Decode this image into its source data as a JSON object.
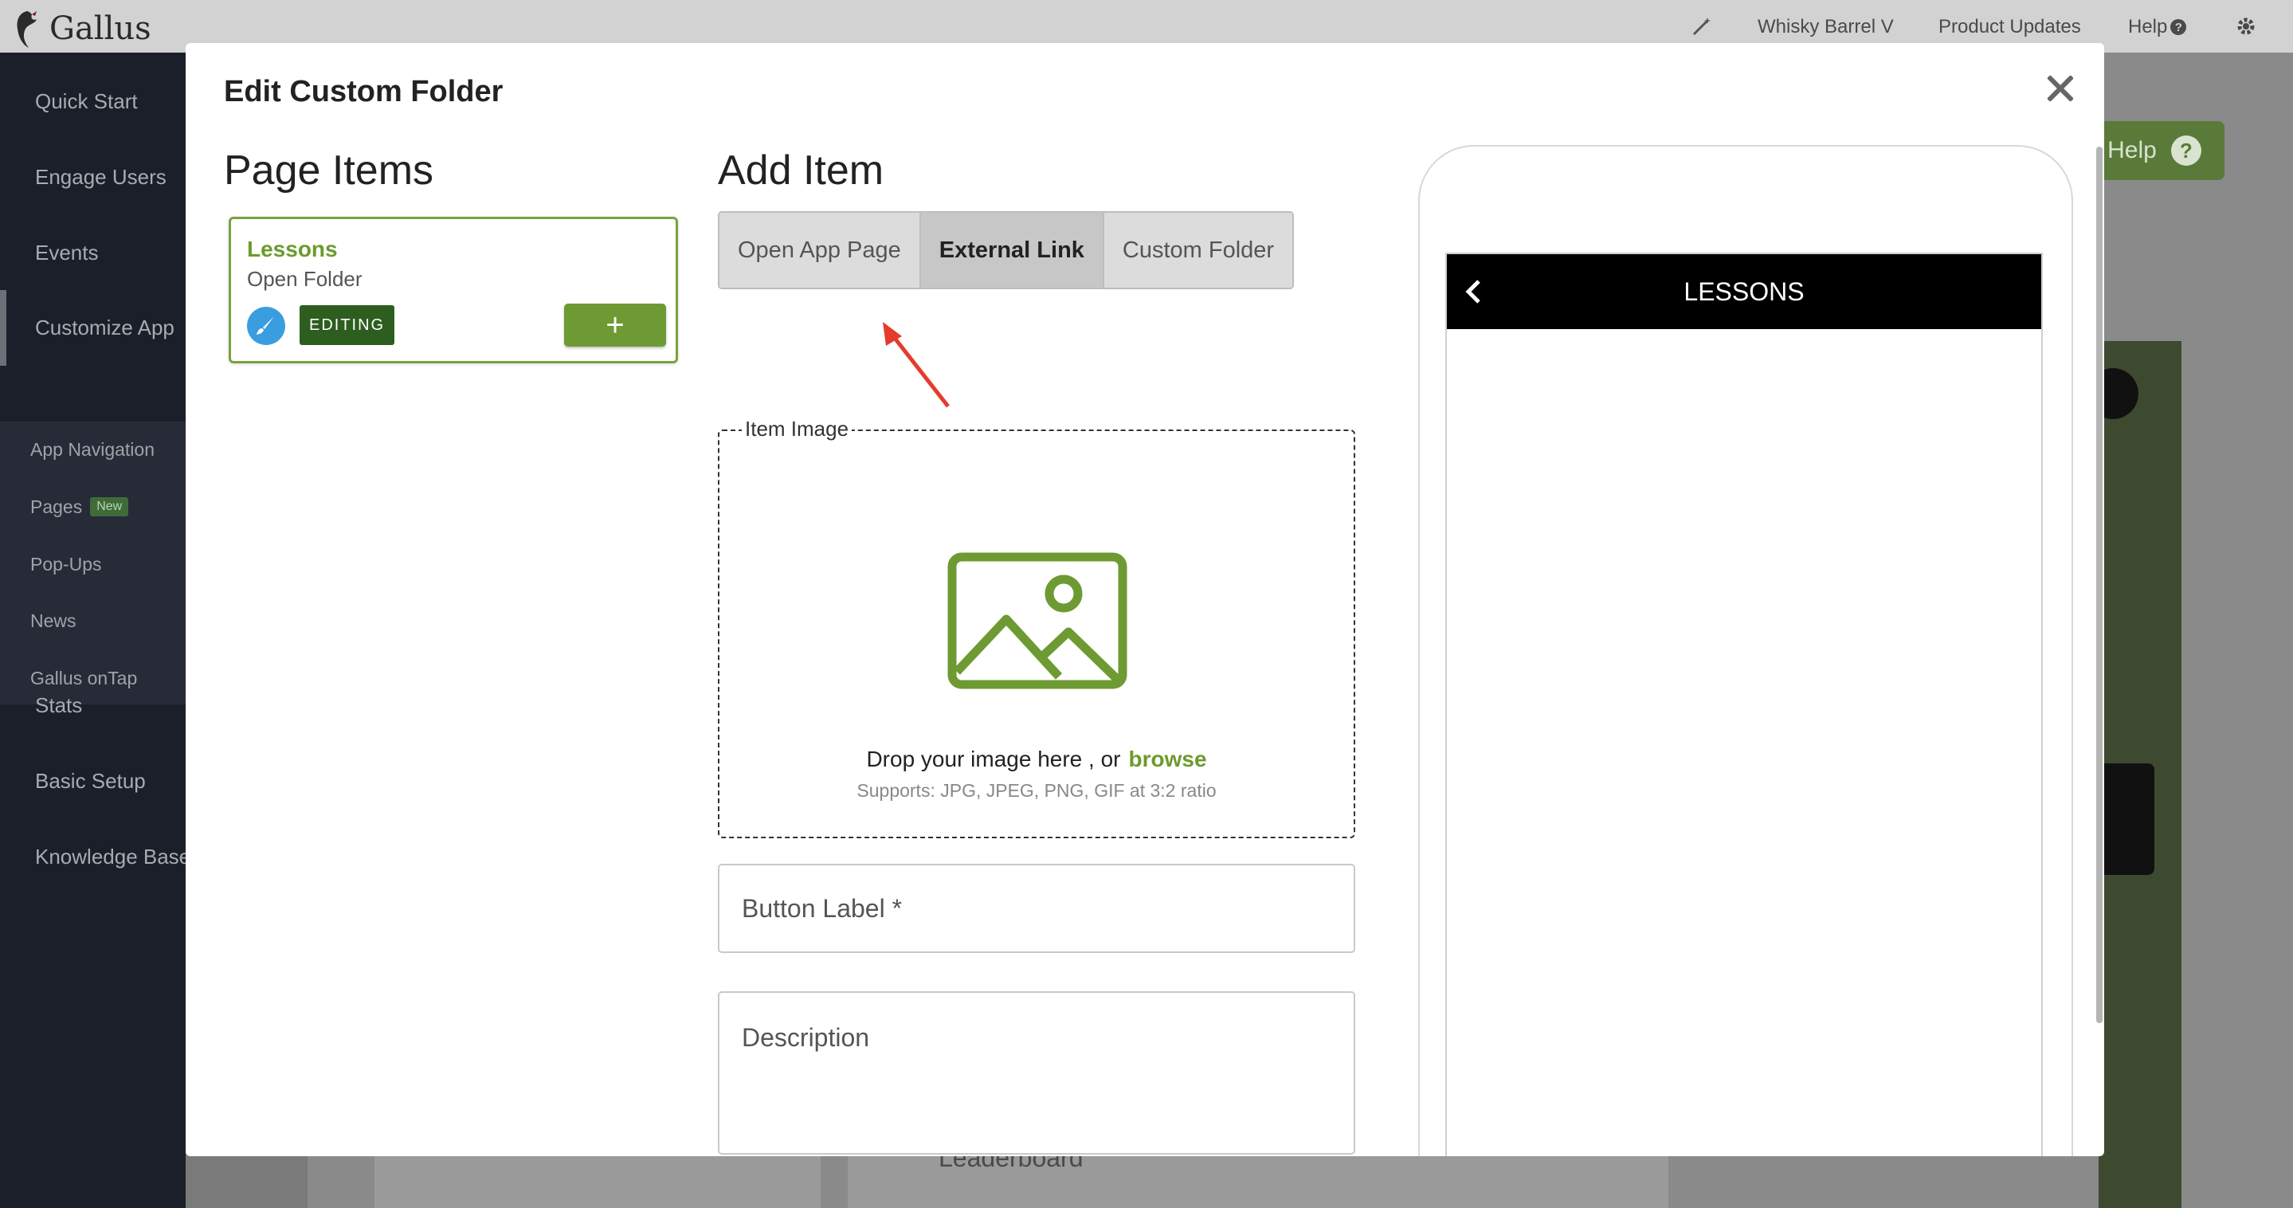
{
  "app": {
    "brand": "Gallus"
  },
  "topnav": {
    "account": "Whisky Barrel V",
    "product_updates": "Product Updates",
    "help": "Help"
  },
  "sidebar": {
    "items": [
      {
        "label": "Quick Start"
      },
      {
        "label": "Engage Users"
      },
      {
        "label": "Events"
      },
      {
        "label": "Customize App"
      },
      {
        "label": "Stats"
      },
      {
        "label": "Basic Setup"
      },
      {
        "label": "Knowledge Base"
      }
    ],
    "sub_items": [
      {
        "label": "App Navigation"
      },
      {
        "label": "Pages",
        "badge": "New"
      },
      {
        "label": "Pop-Ups"
      },
      {
        "label": "News"
      },
      {
        "label": "Gallus onTap"
      }
    ]
  },
  "background": {
    "help_button": "Help",
    "leaderboard": "Leaderboard"
  },
  "modal": {
    "title": "Edit Custom Folder",
    "page_items": {
      "heading": "Page Items",
      "items": [
        {
          "title": "Lessons",
          "subtitle": "Open Folder",
          "status": "EDITING",
          "add_label": "+"
        }
      ]
    },
    "add_item": {
      "heading": "Add Item",
      "tabs": [
        {
          "label": "Open App Page",
          "active": false
        },
        {
          "label": "External Link",
          "active": true
        },
        {
          "label": "Custom Folder",
          "active": false
        }
      ],
      "image": {
        "legend": "Item Image",
        "drop_text": "Drop your image here , or",
        "browse": "browse",
        "supports": "Supports: JPG, JPEG, PNG, GIF at 3:2 ratio"
      },
      "button_label_placeholder": "Button Label *",
      "description_placeholder": "Description"
    },
    "preview": {
      "header_title": "LESSONS"
    }
  },
  "colors": {
    "accent_green": "#6e9a33",
    "editing_badge": "#2e5d20",
    "brush_blue": "#3a9de0",
    "arrow_red": "#e53b2c"
  }
}
